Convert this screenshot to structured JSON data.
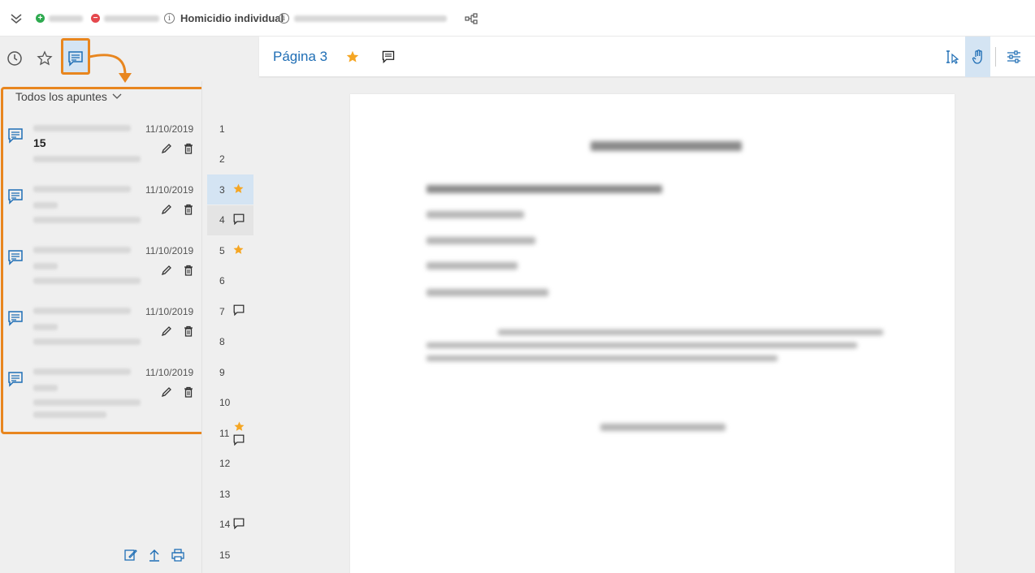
{
  "topbar": {
    "case_title": "Homicidio individual",
    "icons": [
      "collapse-chevrons-icon",
      "add-circle-icon",
      "remove-circle-icon",
      "info-icon",
      "info-icon",
      "tree-icon"
    ],
    "colors": {
      "add": "#2eaa4f",
      "remove": "#e5484d"
    }
  },
  "left_panel": {
    "tabs": [
      "history-icon",
      "favorites-star-icon",
      "notes-comment-icon"
    ],
    "filter_label": "Todos los apuntes",
    "notes": [
      {
        "date": "11/10/2019",
        "title": "15"
      },
      {
        "date": "11/10/2019",
        "title": ""
      },
      {
        "date": "11/10/2019",
        "title": ""
      },
      {
        "date": "11/10/2019",
        "title": ""
      },
      {
        "date": "11/10/2019",
        "title": ""
      }
    ],
    "bottom_icons": [
      "edit-note-icon",
      "upload-icon",
      "print-icon"
    ]
  },
  "page_list": [
    {
      "num": "1",
      "star": false,
      "comment": false
    },
    {
      "num": "2",
      "star": false,
      "comment": false
    },
    {
      "num": "3",
      "star": true,
      "comment": false,
      "selected": true
    },
    {
      "num": "4",
      "star": false,
      "comment": true,
      "hover": true
    },
    {
      "num": "5",
      "star": true,
      "comment": false
    },
    {
      "num": "6",
      "star": false,
      "comment": false
    },
    {
      "num": "7",
      "star": false,
      "comment": true
    },
    {
      "num": "8",
      "star": false,
      "comment": false
    },
    {
      "num": "9",
      "star": false,
      "comment": false
    },
    {
      "num": "10",
      "star": false,
      "comment": false
    },
    {
      "num": "11",
      "star": true,
      "comment": true
    },
    {
      "num": "12",
      "star": false,
      "comment": false
    },
    {
      "num": "13",
      "star": false,
      "comment": false
    },
    {
      "num": "14",
      "star": false,
      "comment": true
    },
    {
      "num": "15",
      "star": false,
      "comment": false
    }
  ],
  "viewer": {
    "page_title": "Página 3",
    "tools": [
      "text-select-icon",
      "hand-pan-icon",
      "settings-sliders-icon"
    ]
  },
  "colors": {
    "accent": "#1f6eb5",
    "highlight": "#e8861f",
    "star": "#f5a623",
    "selected": "#d4e4f3"
  }
}
